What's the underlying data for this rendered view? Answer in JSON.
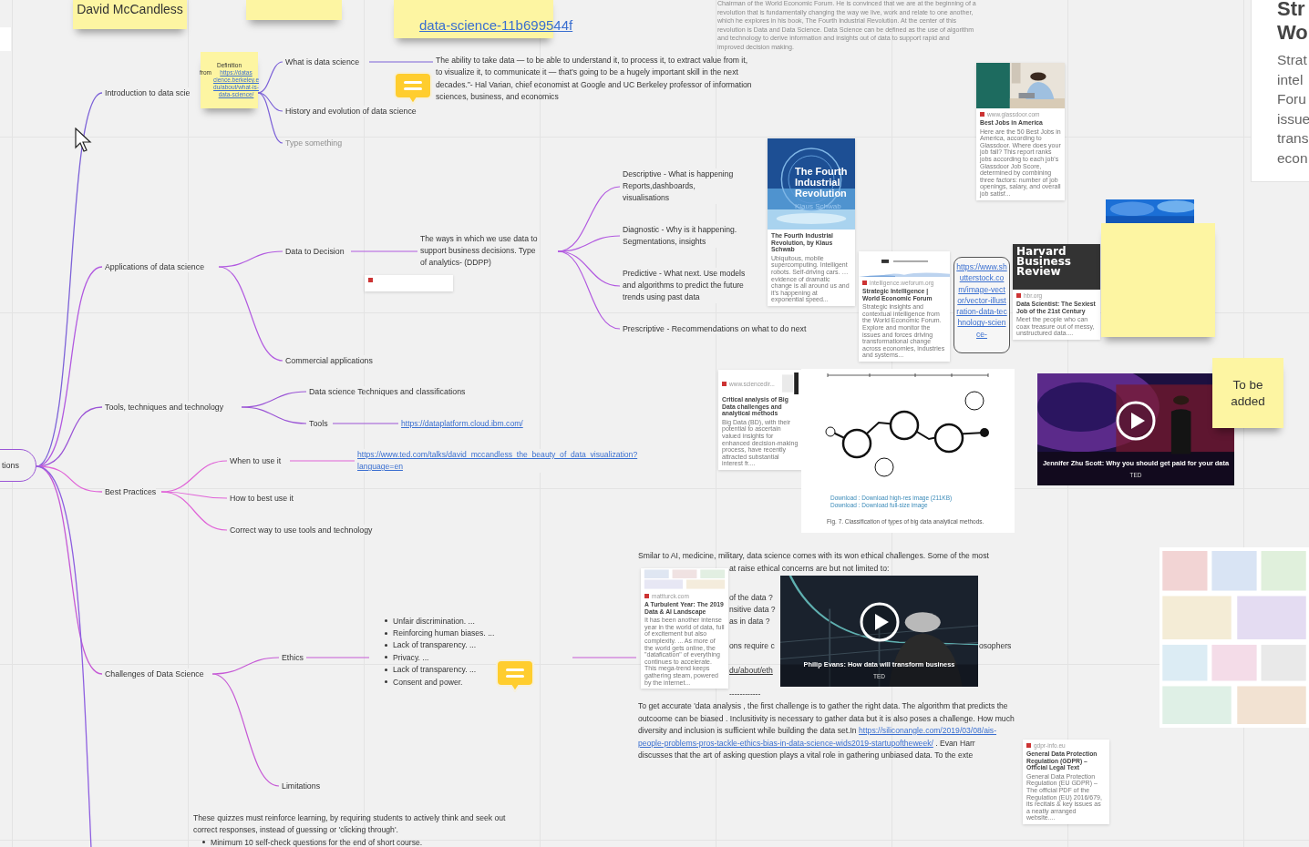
{
  "root": {
    "label": "tions",
    "children": [
      {
        "kind": "topic",
        "label": "Introduction to data scie",
        "color": "#7d62d8",
        "children": [
          {
            "kind": "topic",
            "label": "What is data science",
            "children": [
              {
                "kind": "note",
                "lines": [
                  "The ability to take data — to be able to understand it, to process it, to extract value from it,",
                  "to visualize it, to communicate it — that’s going to be a hugely important skill in the next",
                  "decades.”- Hal Varian, chief economist at Google and UC Berkeley professor of information",
                  "sciences, business, and economics"
                ]
              }
            ]
          },
          {
            "kind": "topic",
            "label": "History and evolution of data science"
          },
          {
            "kind": "placeholder",
            "label": "Type something"
          }
        ]
      },
      {
        "kind": "topic",
        "label": "Applications of data science",
        "color": "#b25ae0",
        "children": [
          {
            "kind": "topic",
            "label": "Data to Decision",
            "children": [
              {
                "kind": "note",
                "lines": [
                  "The ways in which we use data to",
                  "support business decisions. Type",
                  "of analytics- (DDPP)"
                ],
                "children": [
                  {
                    "kind": "note",
                    "lines": [
                      "Descriptive - What is happening",
                      "Reports,dashboards,",
                      "visualisations"
                    ]
                  },
                  {
                    "kind": "note",
                    "lines": [
                      "Diagnostic - Why is it happening.",
                      "Segmentations, insights"
                    ]
                  },
                  {
                    "kind": "note",
                    "lines": [
                      "Predictive - What next. Use models",
                      "and algorithms to predict the future",
                      "trends using past data"
                    ]
                  },
                  {
                    "kind": "topic",
                    "label": "Prescriptive - Recommendations on what to do next"
                  }
                ]
              }
            ]
          },
          {
            "kind": "topic",
            "label": "Commercial applications"
          }
        ]
      },
      {
        "kind": "topic",
        "label": "Tools, techniques  and technology",
        "color": "#9b55d6",
        "children": [
          {
            "kind": "topic",
            "label": "Data science Techniques and classifications"
          },
          {
            "kind": "topic",
            "label": "Tools",
            "children": [
              {
                "kind": "link",
                "lines": [
                  "https://dataplatform.cloud.ibm.com/"
                ]
              }
            ]
          }
        ]
      },
      {
        "kind": "topic",
        "label": "Best Practices",
        "color": "#e064d8",
        "children": [
          {
            "kind": "topic",
            "label": "When to use it",
            "children": [
              {
                "kind": "link",
                "lines": [
                  "https://www.ted.com/talks/david_mccandless_the_beauty_of_data_visualization?",
                  "language=en"
                ]
              }
            ]
          },
          {
            "kind": "topic",
            "label": "How to best use it"
          },
          {
            "kind": "topic",
            "label": "Correct way to use tools and technology"
          }
        ]
      },
      {
        "kind": "topic",
        "label": "Challenges of Data Science",
        "color": "#c65ad6",
        "children": [
          {
            "kind": "topic",
            "label": "Ethics",
            "children": [
              {
                "kind": "bullets",
                "items": [
                  "Unfair discrimination. ...",
                  "Reinforcing human biases. ...",
                  "Lack of transparency. ...",
                  "Privacy. ...",
                  "Lack of transparency. ...",
                  "Consent and power."
                ],
                "children": [
                  {
                    "kind": "fragments",
                    "items": [
                      {
                        "kind": "text",
                        "text": "Smilar to AI, medicine, military, data science comes with its won ethical challenges. Some of the most"
                      },
                      {
                        "kind": "text",
                        "text": "at raise ethical concerns are but not limited to:"
                      },
                      {
                        "kind": "text",
                        "text": "of the data ?"
                      },
                      {
                        "kind": "text",
                        "text": "nsitive data ?"
                      },
                      {
                        "kind": "text",
                        "text": "as in data ?"
                      },
                      {
                        "kind": "text",
                        "text": "ons require c"
                      },
                      {
                        "kind": "text",
                        "text": "osophers"
                      },
                      {
                        "kind": "link",
                        "text": "du/about/eth"
                      },
                      {
                        "kind": "text",
                        "text": "------------"
                      },
                      {
                        "kind": "paragraph",
                        "lines": [
                          [
                            {
                              "text": "To get accurate 'data analysis , the first challenge is to gather the right data. The algorithm that predicts the"
                            }
                          ],
                          [
                            {
                              "text": "outcoome can be biased . Inclusitivity is necessary to gather data but it is also poses a challenge.  How much"
                            }
                          ],
                          [
                            {
                              "text": "diversity and inclusion is sufficient while building the data set.In "
                            },
                            {
                              "link": "https://siliconangle.com/2019/03/08/ais-"
                            }
                          ],
                          [
                            {
                              "link": "people-problems-pros-tackle-ethics-bias-in-data-science-wids2019-startupoftheweek/"
                            },
                            {
                              "text": " .  Evan Harr"
                            }
                          ],
                          [
                            {
                              "text": "discusses that the art of asking question plays a vital role in gathering unbiased data. To the exte"
                            }
                          ]
                        ]
                      }
                    ]
                  }
                ]
              }
            ]
          },
          {
            "kind": "topic",
            "label": "Limitations"
          }
        ]
      }
    ]
  },
  "sticky_notes": [
    {
      "kind": "text",
      "text": "David McCandless"
    },
    {
      "kind": "empty"
    },
    {
      "kind": "link",
      "text": "data-science-11b699544f"
    },
    {
      "kind": "definition",
      "label": "Definition",
      "prefix": "from",
      "link_lines": [
        "https://datas",
        "cience.berkeley.e",
        "du/about/what-is-",
        "data-science/"
      ]
    },
    {
      "kind": "empty"
    },
    {
      "kind": "text",
      "text": "To be added"
    }
  ],
  "top_text": {
    "lines": [
      "Chairman of the World Economic Forum. He is convinced that we are at the beginning of a",
      "revolution that is fundamentally changing the way we live, work and relate to one another,",
      "which he explores in his book, The Fourth Industrial Revolution. At the center of this",
      "revolution is Data and Data Science. Data Science can be defined as the use of algorithm",
      "and technology to derive information and insights out of data to support rapid and",
      "improved decision making."
    ]
  },
  "side_card": {
    "title_lines": [
      "Str",
      "Wo"
    ],
    "description_lines": [
      "Strat",
      "intel",
      "Foru",
      "issue",
      "trans",
      "econ"
    ]
  },
  "link_cards": [
    {
      "domain": "www.glassdoor.com",
      "title": "Best Jobs in America",
      "description": "Here are the 50 Best Jobs in America, according to Glassdoor. Where does your job fall? This report ranks jobs according to each job's Glassdoor Job Score, determined by combining three factors: number of job openings, salary, and overall job satisf..."
    },
    {
      "kind": "book",
      "cover_title": "The Fourth Industrial Revolution",
      "cover_author": "Klaus Schwab",
      "title": "The Fourth Industrial Revolution, by Klaus Schwab",
      "description": "Ubiquitous, mobile supercomputing. Intelligent robots. Self-driving cars. … evidence of dramatic change is all around us and it's happening at exponential speed..."
    },
    {
      "domain": "intelligence.weforum.org",
      "title": "Strategic Intelligence | World Economic Forum",
      "description": "Strategic insights and contextual intelligence from the World Economic Forum. Explore and monitor the issues and forces driving transformational change across economies, industries and systems..."
    },
    {
      "kind": "url",
      "text": "https://www.shutterstock.com/image-vector/vector-illustration-data-technology-science-"
    },
    {
      "kind": "header",
      "header": "Harvard Business Review",
      "domain": "hbr.org",
      "title": "Data Scientist: The Sexiest Job of the 21st Century",
      "description": "Meet the people who can coax treasure out of messy, unstructured data...."
    },
    {
      "kind": "stub"
    },
    {
      "kind": "side",
      "domain": "www.sciencedir...",
      "title": "Critical analysis of Big Data challenges and analytical methods",
      "description": "Big Data (BD), with their potential to ascertain valued insights for enhanced decision-making process, have recently attracted substantial interest fr...."
    },
    {
      "domain": "mattturck.com",
      "title": "A Turbulent Year: The 2019 Data & AI Landscape",
      "description": "It has been another intense year in the world of data, full of excitement but also complexity. ... As more of the world gets online, the \"datafication\" of everything continues to accelerate. This mega-trend keeps gathering steam, powered by the internet..."
    },
    {
      "kind": "text",
      "domain": "gdpr-info.eu",
      "title": "General Data Protection Regulation (GDPR) – Official Legal Text",
      "description": "General Data Protection Regulation (EU GDPR) – The official PDF of the Regulation (EU) 2016/679, its recitals & key issues as a neatly arranged website...."
    }
  ],
  "diagram": {
    "downloads": [
      "Download : Download high-res image (211KB)",
      "Download : Download full-size image"
    ],
    "caption": "Fig. 7. Classification of types of big data analytical methods."
  },
  "videos": [
    {
      "title": "Jennifer Zhu Scott: Why you should get paid for your data",
      "source": "TED"
    },
    {
      "title": "Philip Evans: How data will transform business",
      "source": "TED"
    }
  ],
  "bottom_note": {
    "lines": [
      "These quizzes must reinforce learning, by requiring students to actively think and seek out",
      "correct responses, instead of guessing or 'clicking through'."
    ],
    "bullets": [
      "Minimum 10 self-check questions for the end of short course."
    ]
  }
}
